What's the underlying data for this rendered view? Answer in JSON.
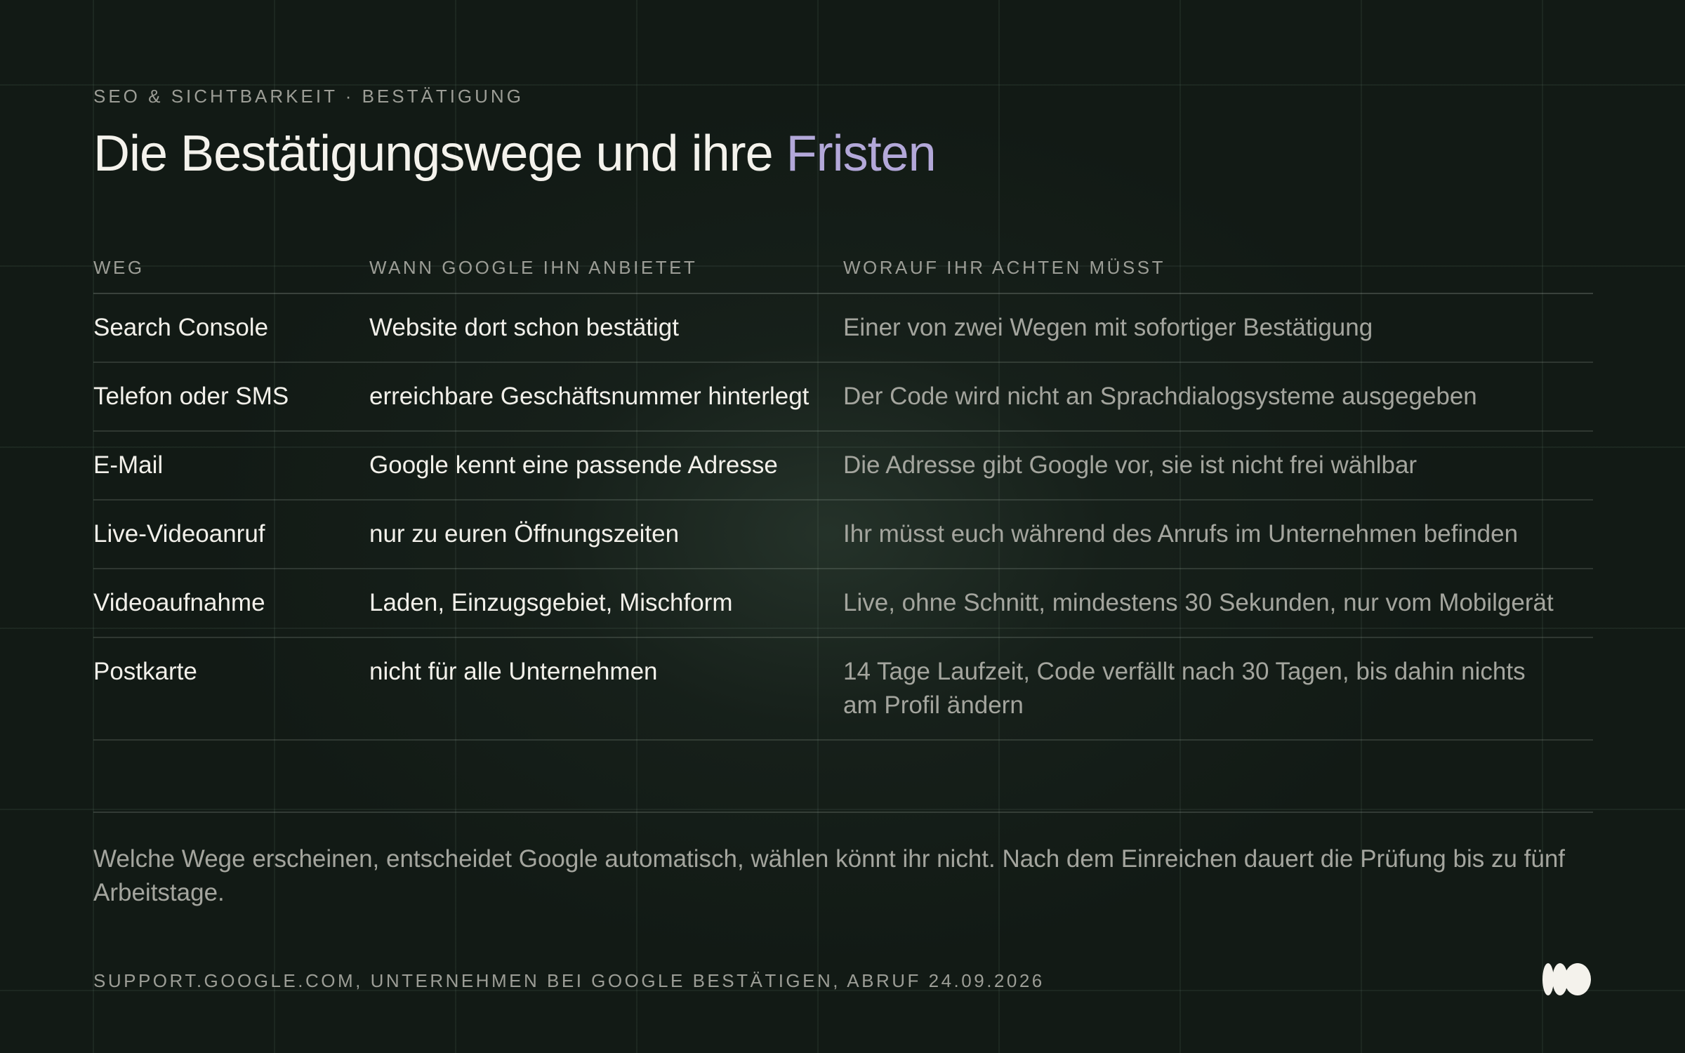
{
  "header": {
    "eyebrow": "SEO & SICHTBARKEIT · BESTÄTIGUNG",
    "title_main": "Die Bestätigungswege und ihre ",
    "title_accent": "Fristen"
  },
  "table": {
    "columns": [
      "WEG",
      "WANN GOOGLE IHN ANBIETET",
      "WORAUF IHR ACHTEN MÜSST"
    ],
    "rows": [
      [
        "Search Console",
        "Website dort schon bestätigt",
        "Einer von zwei Wegen mit sofortiger Bestätigung"
      ],
      [
        "Telefon oder SMS",
        "erreichbare Geschäftsnummer hinterlegt",
        "Der Code wird nicht an Sprachdialogsysteme ausgegeben"
      ],
      [
        "E-Mail",
        "Google kennt eine passende Adresse",
        "Die Adresse gibt Google vor, sie ist nicht frei wählbar"
      ],
      [
        "Live-Videoanruf",
        "nur zu euren Öffnungszeiten",
        "Ihr müsst euch während des Anrufs im Unternehmen befinden"
      ],
      [
        "Videoaufnahme",
        "Laden, Einzugsgebiet, Mischform",
        "Live, ohne Schnitt, mindestens 30 Sekunden, nur vom Mobilgerät"
      ],
      [
        "Postkarte",
        "nicht für alle Unternehmen",
        "14 Tage Laufzeit, Code verfällt nach 30 Tagen, bis dahin nichts am Profil ändern"
      ]
    ]
  },
  "note": "Welche Wege erscheinen, entscheidet Google automatisch, wählen könnt ihr nicht. Nach dem Einreichen dauert die Prüfung bis zu fünf Arbeitstage.",
  "footer": {
    "source": "SUPPORT.GOOGLE.COM, UNTERNEHMEN BEI GOOGLE BESTÄTIGEN, ABRUF 24.09.2026",
    "logo_icon": "brand-logo-icon"
  },
  "colors": {
    "background": "#121a15",
    "accent": "#b3a8d9",
    "text_primary": "#f2f0ea",
    "text_secondary": "#a4a59e"
  }
}
